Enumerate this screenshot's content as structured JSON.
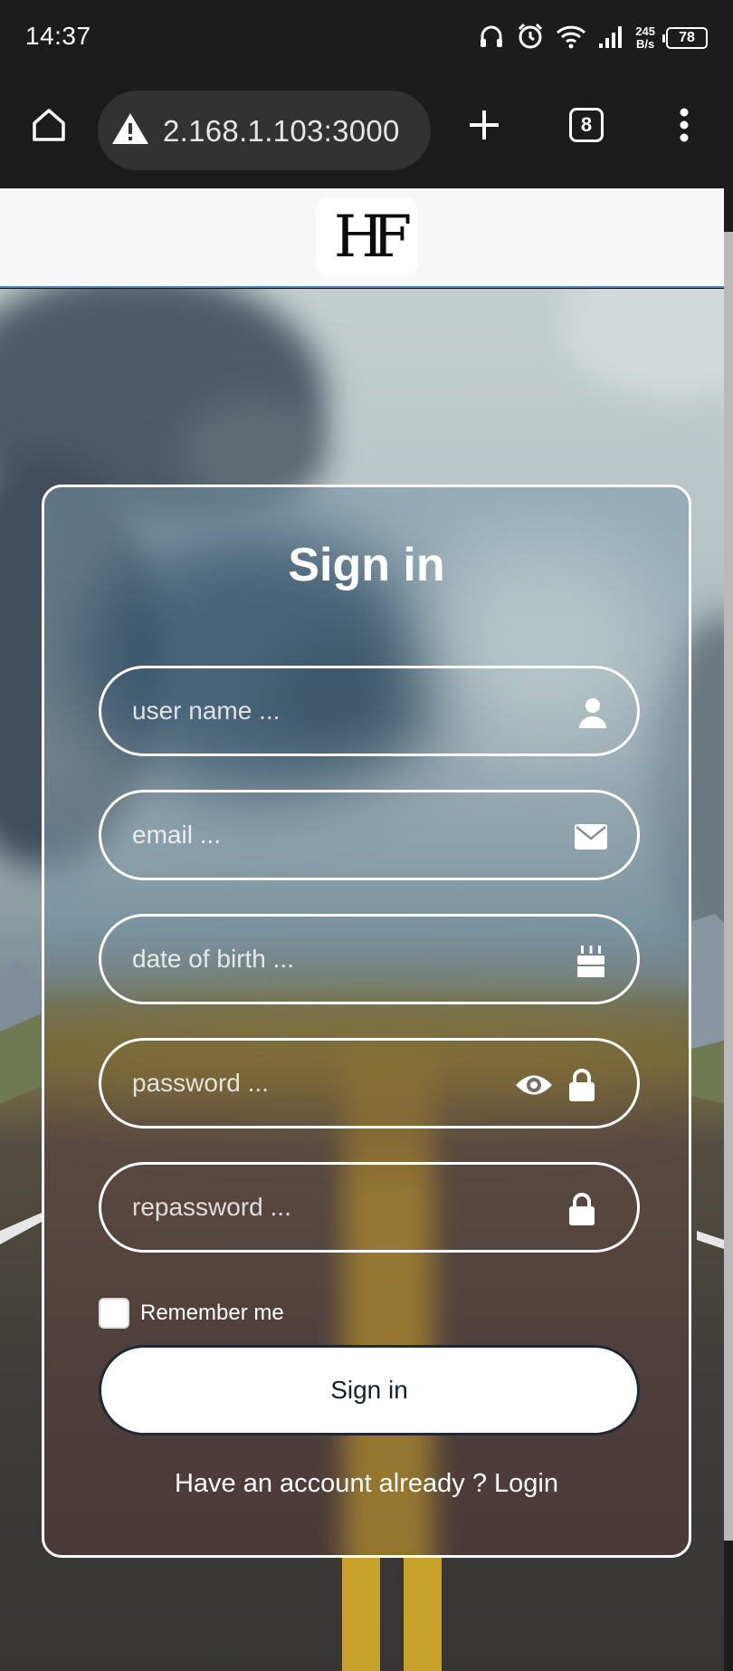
{
  "status_bar": {
    "time": "14:37",
    "net_speed_value": "245",
    "net_speed_unit": "B/s",
    "battery": "78"
  },
  "browser": {
    "url": "2.168.1.103:3000",
    "tab_count": "8",
    "icons": [
      "home-icon",
      "warning-icon",
      "new-tab-icon",
      "tabs-icon",
      "more-menu-icon"
    ]
  },
  "header": {
    "logo_text": "HF"
  },
  "form": {
    "title": "Sign in",
    "fields": {
      "username": {
        "placeholder": "user name ...",
        "icon": "user-icon"
      },
      "email": {
        "placeholder": "email ...",
        "icon": "envelope-icon"
      },
      "dob": {
        "placeholder": "date of birth ...",
        "icon": "birthday-cake-icon"
      },
      "password": {
        "placeholder": "password ...",
        "icon": "lock-icon",
        "toggle_icon": "eye-icon"
      },
      "repassword": {
        "placeholder": "repassword ...",
        "icon": "lock-icon"
      }
    },
    "remember_label": "Remember me",
    "remember_checked": false,
    "submit_label": "Sign in",
    "login_prompt": "Have an account already ? Login"
  },
  "colors": {
    "accent_line": "#3d7fc5",
    "card_border": "#ffffff",
    "button_text": "#14212b"
  }
}
